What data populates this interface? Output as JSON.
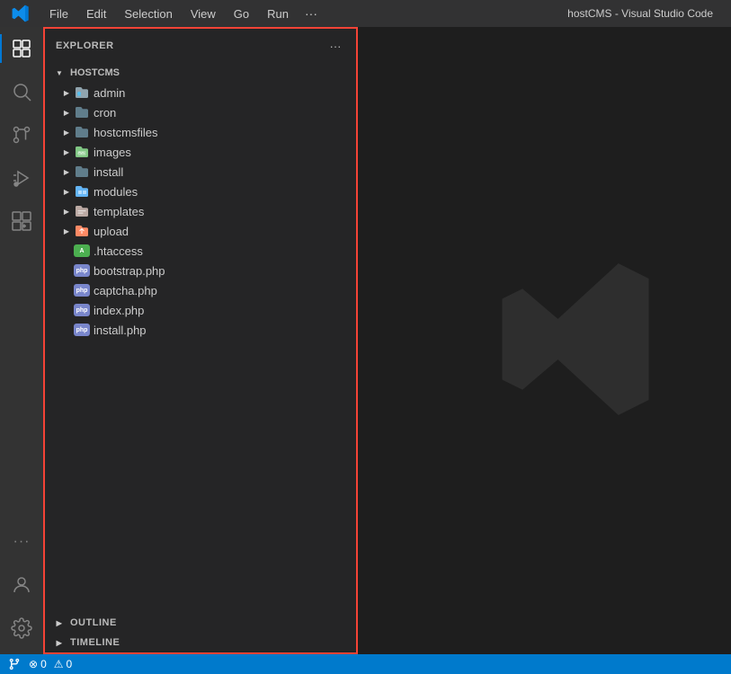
{
  "titlebar": {
    "menu_items": [
      "File",
      "Edit",
      "Selection",
      "View",
      "Go",
      "Run",
      "..."
    ],
    "title": "hostCMS - Visual Studio Code"
  },
  "sidebar": {
    "explorer_label": "EXPLORER",
    "root_label": "HOSTCMS",
    "items": [
      {
        "name": "admin",
        "type": "folder",
        "icon": "folder-admin",
        "indent": 1
      },
      {
        "name": "cron",
        "type": "folder",
        "icon": "folder-basic",
        "indent": 1
      },
      {
        "name": "hostcmsfiles",
        "type": "folder",
        "icon": "folder-basic",
        "indent": 1
      },
      {
        "name": "images",
        "type": "folder",
        "icon": "folder-images",
        "indent": 1
      },
      {
        "name": "install",
        "type": "folder",
        "icon": "folder-basic",
        "indent": 1
      },
      {
        "name": "modules",
        "type": "folder",
        "icon": "folder-modules",
        "indent": 1
      },
      {
        "name": "templates",
        "type": "folder",
        "icon": "folder-templates",
        "indent": 1
      },
      {
        "name": "upload",
        "type": "folder",
        "icon": "folder-upload",
        "indent": 1
      },
      {
        "name": ".htaccess",
        "type": "htaccess",
        "icon": "htaccess",
        "indent": 1
      },
      {
        "name": "bootstrap.php",
        "type": "php",
        "icon": "php",
        "indent": 1
      },
      {
        "name": "captcha.php",
        "type": "php",
        "icon": "php",
        "indent": 1
      },
      {
        "name": "index.php",
        "type": "php",
        "icon": "php",
        "indent": 1
      },
      {
        "name": "install.php",
        "type": "php",
        "icon": "php",
        "indent": 1
      }
    ],
    "outline_label": "OUTLINE",
    "timeline_label": "TIMELINE"
  },
  "statusbar": {
    "errors": "0",
    "warnings": "0"
  },
  "activity_bar": {
    "items": [
      "explorer",
      "search",
      "source-control",
      "run-debug",
      "extensions"
    ]
  }
}
